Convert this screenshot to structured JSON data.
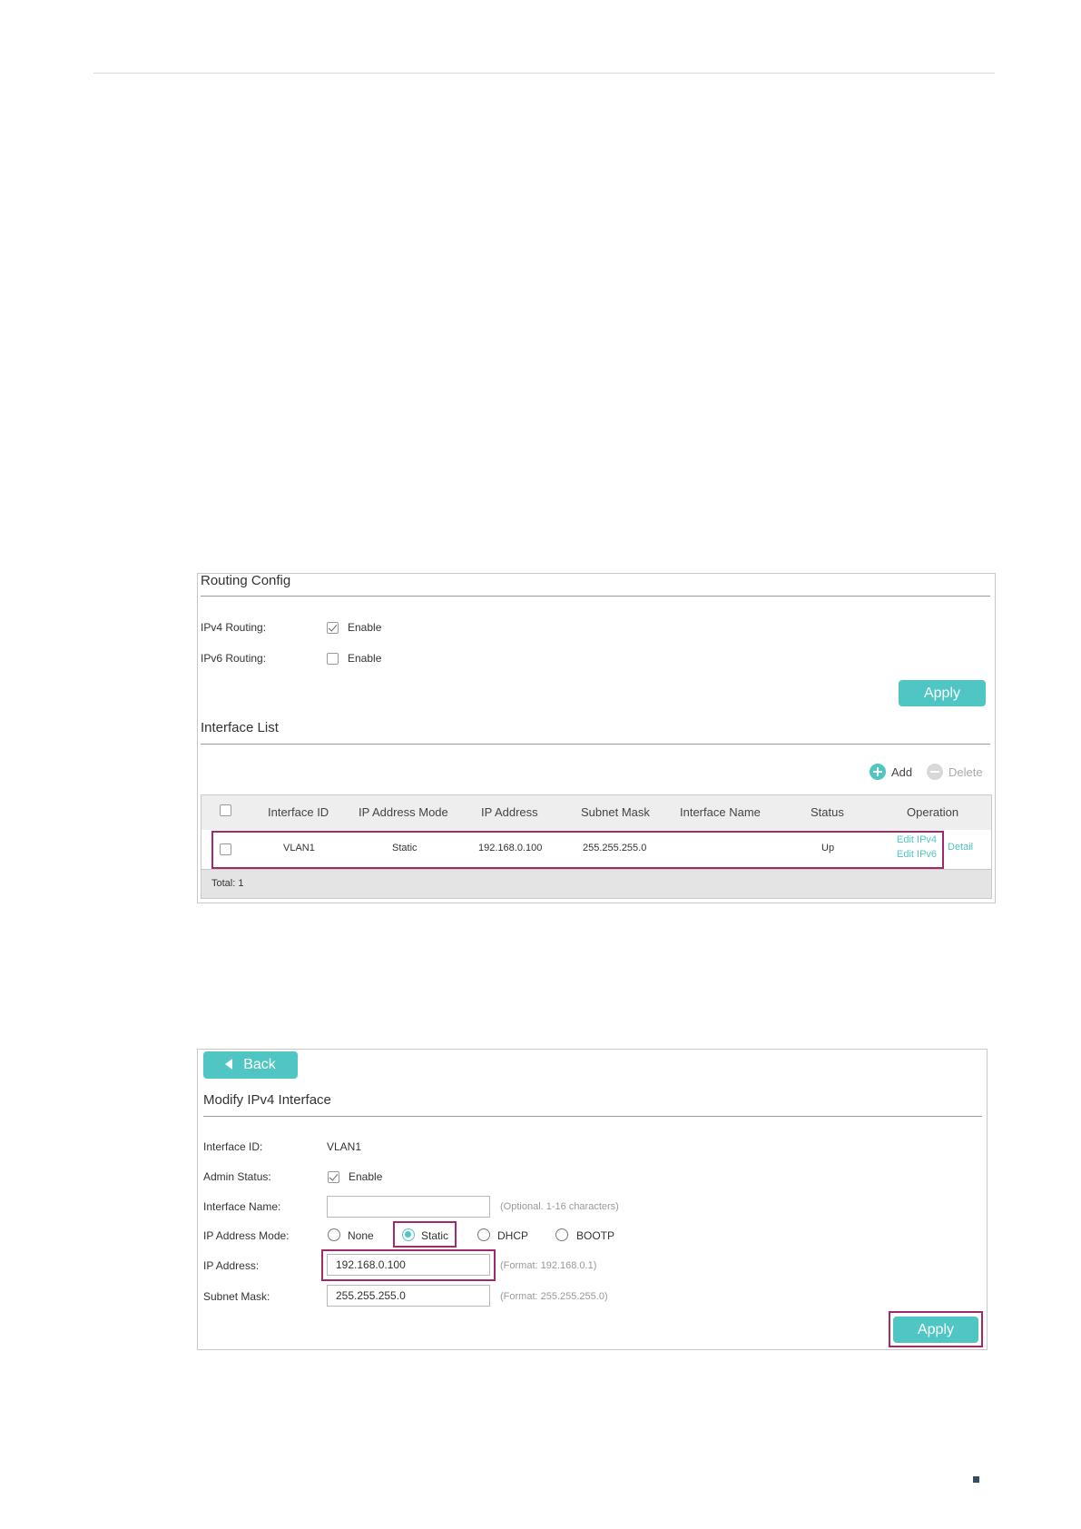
{
  "routing_config": {
    "title": "Routing Config",
    "ipv4_label": "IPv4 Routing:",
    "ipv4_option": "Enable",
    "ipv4_checked": true,
    "ipv6_label": "IPv6 Routing:",
    "ipv6_option": "Enable",
    "ipv6_checked": false,
    "apply_label": "Apply"
  },
  "interface_list": {
    "title": "Interface List",
    "add_label": "Add",
    "delete_label": "Delete",
    "columns": [
      "Interface ID",
      "IP Address Mode",
      "IP Address",
      "Subnet Mask",
      "Interface Name",
      "Status",
      "Operation"
    ],
    "rows": [
      {
        "interface_id": "VLAN1",
        "ip_mode": "Static",
        "ip_address": "192.168.0.100",
        "subnet_mask": "255.255.255.0",
        "interface_name": "",
        "status": "Up",
        "edit_ipv4": "Edit IPv4",
        "edit_ipv6": "Edit IPv6",
        "detail": "Detail"
      }
    ],
    "total": "Total: 1"
  },
  "modify_ipv4": {
    "back_label": "Back",
    "title": "Modify IPv4 Interface",
    "interface_id_label": "Interface ID:",
    "interface_id_value": "VLAN1",
    "admin_status_label": "Admin Status:",
    "admin_status_option": "Enable",
    "admin_status_checked": true,
    "interface_name_label": "Interface Name:",
    "interface_name_value": "",
    "interface_name_hint": "(Optional. 1-16 characters)",
    "ip_mode_label": "IP Address Mode:",
    "ip_mode_options": [
      "None",
      "Static",
      "DHCP",
      "BOOTP"
    ],
    "ip_mode_selected": "Static",
    "ip_address_label": "IP Address:",
    "ip_address_value": "192.168.0.100",
    "ip_address_hint": "(Format: 192.168.0.1)",
    "subnet_mask_label": "Subnet Mask:",
    "subnet_mask_value": "255.255.255.0",
    "subnet_mask_hint": "(Format: 255.255.255.0)",
    "apply_label": "Apply"
  },
  "colors": {
    "accent": "#4fc6c3",
    "highlight": "#a2296b"
  }
}
